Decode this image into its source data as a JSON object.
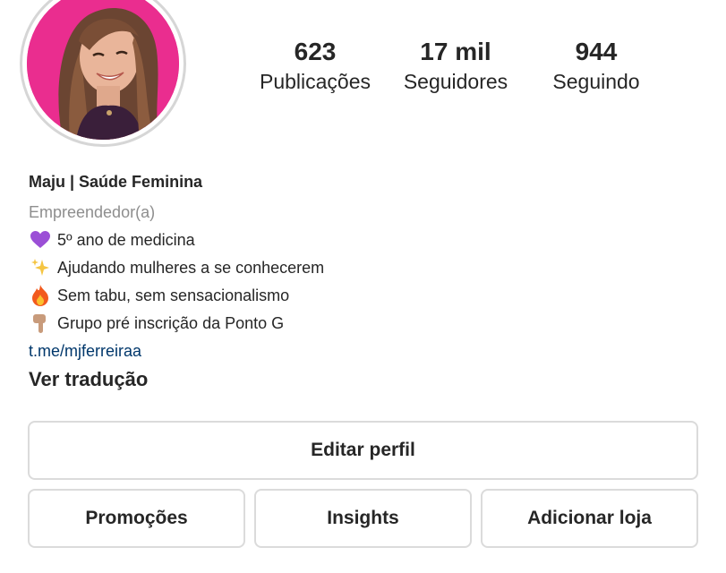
{
  "profile": {
    "avatar_alt": "profile-photo",
    "stats": {
      "posts": {
        "value": "623",
        "label": "Publicações"
      },
      "followers": {
        "value": "17 mil",
        "label": "Seguidores"
      },
      "following": {
        "value": "944",
        "label": "Seguindo"
      }
    },
    "bio": {
      "name": "Maju | Saúde Feminina",
      "category": "Empreendedor(a)",
      "lines": [
        {
          "icon": "purple-heart-icon",
          "text": "5º ano de medicina"
        },
        {
          "icon": "sparkles-icon",
          "text": "Ajudando mulheres a se conhecerem"
        },
        {
          "icon": "fire-icon",
          "text": "Sem tabu, sem sensacionalismo"
        },
        {
          "icon": "pointing-down-hand-icon",
          "text": "Grupo pré inscrição da Ponto G"
        }
      ],
      "link": "t.me/mjferreiraa",
      "translate": "Ver tradução"
    },
    "buttons": {
      "edit": "Editar perfil",
      "promotions": "Promoções",
      "insights": "Insights",
      "add_shop": "Adicionar loja"
    },
    "colors": {
      "avatar_background": "#ea2d8f",
      "link": "#00376b",
      "muted": "#8e8e8e",
      "button_border": "#dbdbdb"
    }
  }
}
